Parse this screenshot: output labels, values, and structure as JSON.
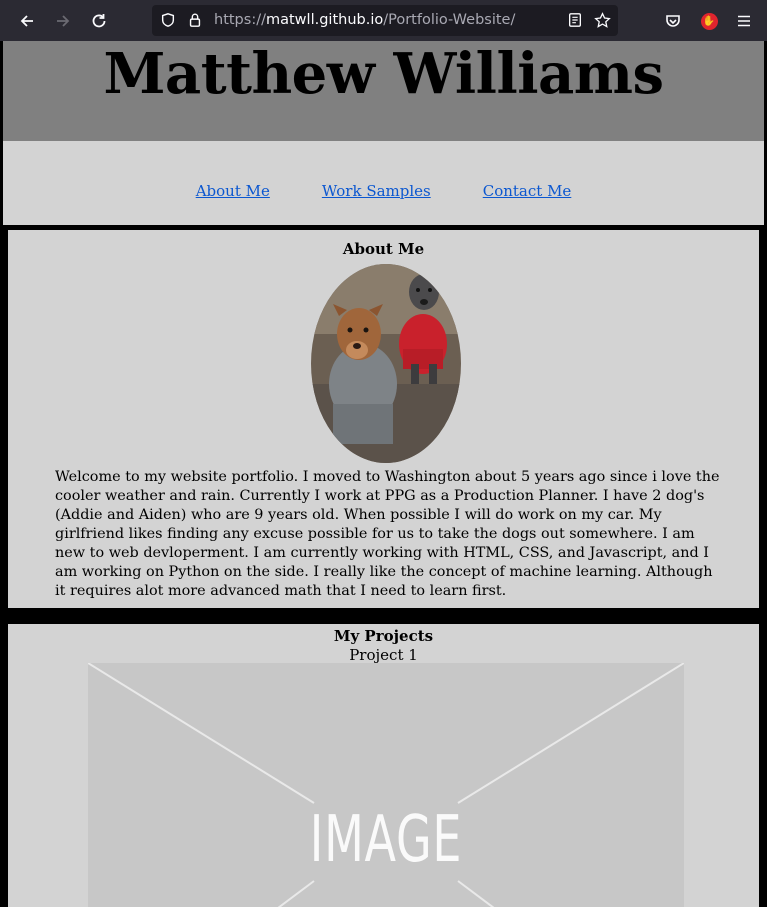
{
  "browser": {
    "url_prefix": "https://",
    "url_host": "matwll.github.io",
    "url_path": "/Portfolio-Website/"
  },
  "header": {
    "title": "Matthew Williams"
  },
  "nav": {
    "items": [
      "About Me",
      "Work Samples",
      "Contact Me"
    ]
  },
  "about": {
    "title": "About Me",
    "text": "Welcome to my website portfolio. I moved to Washington about 5 years ago since i love the cooler weather and rain. Currently I work at PPG as a Production Planner. I have 2 dog's (Addie and Aiden) who are 9 years old. When possible I will do work on my car. My girlfriend likes finding any excuse possible for us to take the dogs out somewhere. I am new to web devloperment. I am currently working with HTML, CSS, and Javascript, and I am working on Python on the side. I really like the concept of machine learning. Although it requires alot more advanced math that I need to learn first."
  },
  "projects": {
    "title": "My Projects",
    "project_label": "Project 1",
    "image_placeholder": "IMAGE"
  },
  "colors": {
    "header_bg": "#808080",
    "section_bg": "#d3d3d3",
    "link": "#0b57d0"
  }
}
